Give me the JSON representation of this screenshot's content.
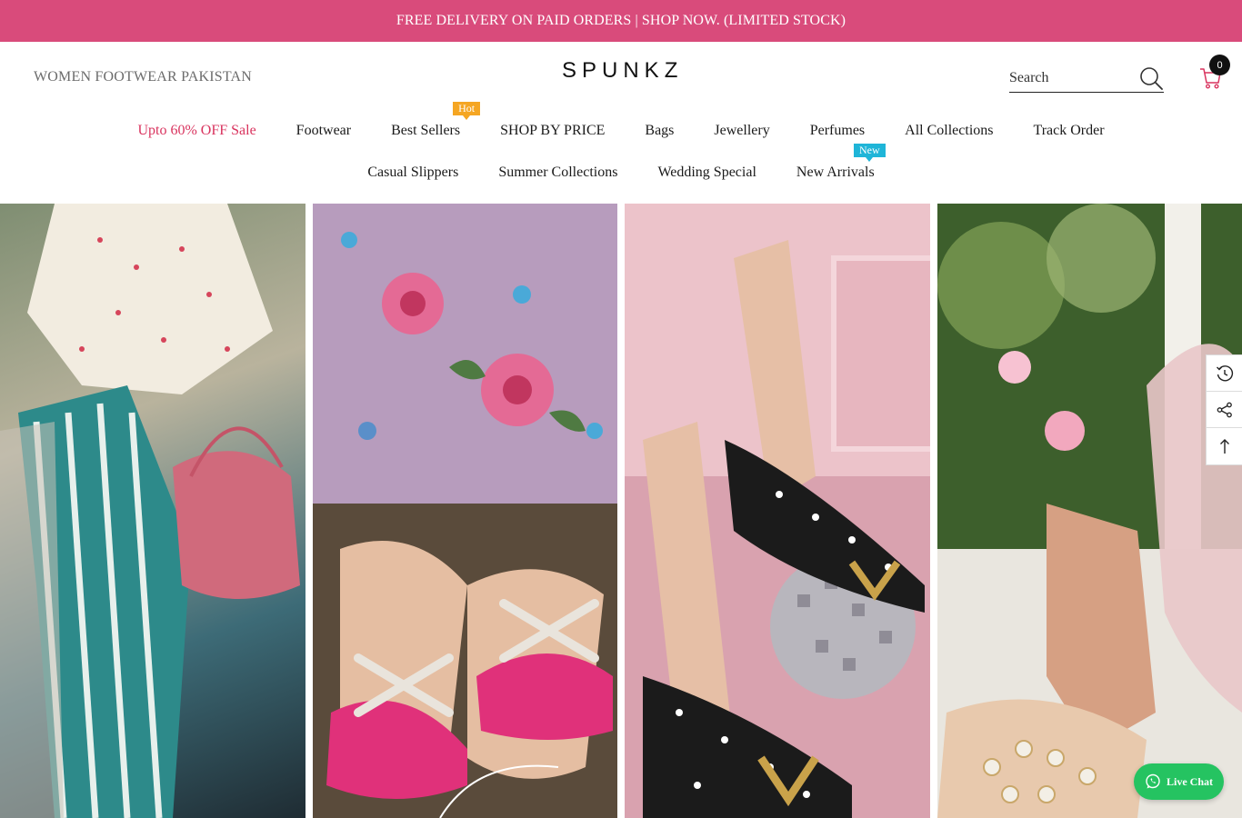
{
  "announcement": {
    "text": "FREE DELIVERY ON PAID ORDERS | SHOP NOW. (LIMITED STOCK)",
    "bg_color": "#d94b7b"
  },
  "header": {
    "tagline": "WOMEN FOOTWEAR PAKISTAN",
    "logo": "SPUNKZ",
    "search": {
      "placeholder": "Search",
      "icon": "search-icon"
    },
    "cart": {
      "icon": "cart-icon",
      "count": "0"
    }
  },
  "nav": {
    "row1": [
      {
        "label": "Upto 60% OFF Sale",
        "color": "#d9335e"
      },
      {
        "label": "Footwear"
      },
      {
        "label": "Best Sellers",
        "badge": "Hot",
        "badge_color": "#f5a623"
      },
      {
        "label": "SHOP BY PRICE"
      },
      {
        "label": "Bags"
      },
      {
        "label": "Jewellery"
      },
      {
        "label": "Perfumes"
      },
      {
        "label": "All Collections"
      },
      {
        "label": "Track Order"
      }
    ],
    "row2": [
      {
        "label": "Casual Slippers"
      },
      {
        "label": "Summer Collections"
      },
      {
        "label": "Wedding Special"
      },
      {
        "label": "New Arrivals",
        "badge": "New",
        "badge_color": "#1fb5d8"
      }
    ]
  },
  "side_tools": [
    {
      "icon": "recently-viewed-icon"
    },
    {
      "icon": "share-icon"
    },
    {
      "icon": "back-to-top-icon"
    }
  ],
  "live_chat": {
    "label": "Live Chat",
    "icon": "whatsapp-icon",
    "color": "#25c361"
  }
}
